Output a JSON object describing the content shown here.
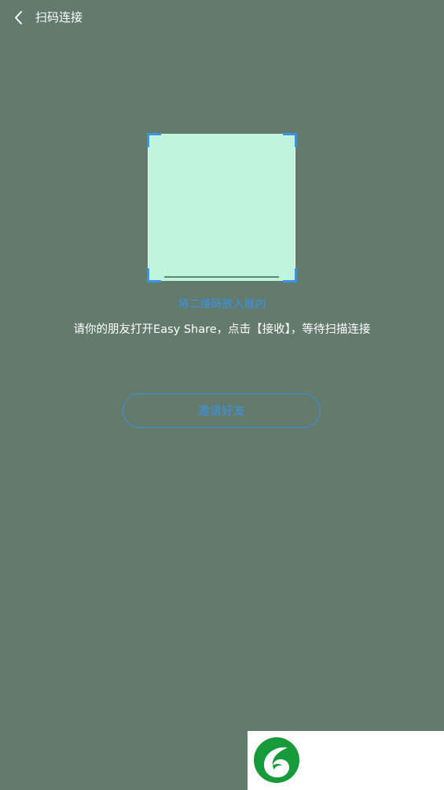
{
  "header": {
    "back_icon": "chevron-left-icon",
    "title": "扫码连接"
  },
  "scanner": {
    "hint": "将二维码放入框内",
    "instruction": "请你的朋友打开Easy Share，点击【接收】，等待扫描连接"
  },
  "actions": {
    "invite_label": "邀请好友"
  },
  "watermark": {
    "logo_icon": "leaf-logo-icon"
  },
  "colors": {
    "background": "#627b6c",
    "accent": "#3a92e6",
    "scan_area": "#c0f4dd",
    "logo_green": "#179a3a"
  }
}
